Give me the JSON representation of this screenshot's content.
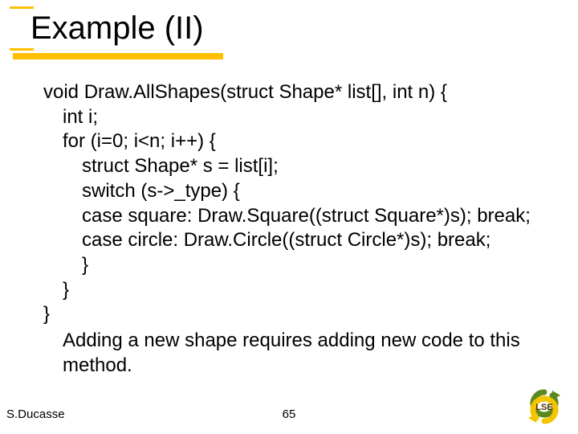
{
  "title": "Example (II)",
  "code": {
    "signature": "void Draw.AllShapes(struct Shape* list[], int n) {",
    "lines": [
      "int i;",
      "for (i=0; i<n; i++) {",
      "struct Shape* s = list[i];",
      "switch (s->_type) {",
      "case square: Draw.Square((struct Square*)s); break;",
      "case circle: Draw.Circle((struct Circle*)s); break;",
      "}",
      "}",
      "}"
    ],
    "note": "Adding a new shape requires adding new code to this method."
  },
  "footer": {
    "author": "S.Ducasse",
    "page": "65"
  },
  "logo_label": "LSE"
}
